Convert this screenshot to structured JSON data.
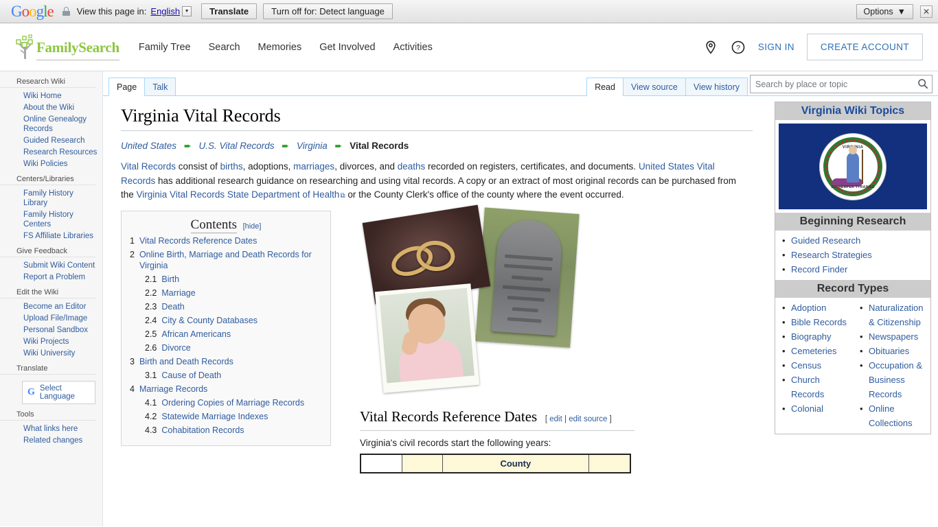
{
  "translate_bar": {
    "logo": "Google",
    "lock_icon": "lock-icon",
    "view_label": "View this page in:",
    "language": "English",
    "caret_icon": "chevron-down-icon",
    "translate_button": "Translate",
    "turn_off_button": "Turn off for: Detect language",
    "options_button": "Options",
    "options_caret": "▼",
    "close_icon": "✕"
  },
  "header": {
    "logo_text": "FamilySearch",
    "tree_icon": "family-tree-icon",
    "nav": [
      {
        "label": "Family Tree"
      },
      {
        "label": "Search"
      },
      {
        "label": "Memories"
      },
      {
        "label": "Get Involved"
      },
      {
        "label": "Activities"
      }
    ],
    "location_icon": "map-pin-icon",
    "help_icon": "help-circle-icon",
    "sign_in": "SIGN IN",
    "create_account": "CREATE ACCOUNT"
  },
  "sidebar": {
    "groups": [
      {
        "title": "Research Wiki",
        "items": [
          "Wiki Home",
          "About the Wiki",
          "Online Genealogy Records",
          "Guided Research",
          "Research Resources",
          "Wiki Policies"
        ]
      },
      {
        "title": "Centers/Libraries",
        "items": [
          "Family History Library",
          "Family History Centers",
          "FS Affiliate Libraries"
        ]
      },
      {
        "title": "Give Feedback",
        "items": [
          "Submit Wiki Content",
          "Report a Problem"
        ]
      },
      {
        "title": "Edit the Wiki",
        "items": [
          "Become an Editor",
          "Upload File/Image",
          "Personal Sandbox",
          "Wiki Projects",
          "Wiki University"
        ]
      },
      {
        "title": "Translate",
        "items": []
      },
      {
        "title": "Tools",
        "items": [
          "What links here",
          "Related changes"
        ]
      }
    ],
    "select_language": "Select Language",
    "google_g": "G"
  },
  "tabs": {
    "left": [
      {
        "label": "Page",
        "active": true
      },
      {
        "label": "Talk",
        "active": false
      }
    ],
    "right": [
      {
        "label": "Read",
        "active": true
      },
      {
        "label": "View source",
        "active": false
      },
      {
        "label": "View history",
        "active": false
      }
    ]
  },
  "search": {
    "placeholder": "Search by place or topic",
    "value": "",
    "icon": "search-icon"
  },
  "article": {
    "title": "Virginia Vital Records",
    "breadcrumb": [
      {
        "label": "United States",
        "current": false
      },
      {
        "label": "U.S. Vital Records",
        "current": false
      },
      {
        "label": "Virginia",
        "current": false
      },
      {
        "label": "Vital Records",
        "current": true
      }
    ],
    "arrow_icon": "➨",
    "intro": {
      "p1_a": "Vital Records",
      "p1_b": " consist of ",
      "p1_births": "births",
      "p1_c": ", adoptions, ",
      "p1_marriages": "marriages",
      "p1_d": ", divorces, and ",
      "p1_deaths": "deaths",
      "p1_e": " recorded on registers, certificates, and documents. ",
      "p1_usvr": "United States Vital Records",
      "p1_f": " has additional research guidance on researching and using vital records. A copy or an extract of most original records can be purchased from the ",
      "p1_dept": "Virginia Vital Records State Department of Health",
      "p1_g": " or the County Clerk's office of the county where the event occurred."
    },
    "toc": {
      "title": "Contents",
      "hide": "[hide]",
      "entries": [
        {
          "num": "1",
          "text": "Vital Records Reference Dates",
          "level": 1
        },
        {
          "num": "2",
          "text": "Online Birth, Marriage and Death Records for Virginia",
          "level": 1
        },
        {
          "num": "2.1",
          "text": "Birth",
          "level": 2
        },
        {
          "num": "2.2",
          "text": "Marriage",
          "level": 2
        },
        {
          "num": "2.3",
          "text": "Death",
          "level": 2
        },
        {
          "num": "2.4",
          "text": "City & County Databases",
          "level": 2
        },
        {
          "num": "2.5",
          "text": "African Americans",
          "level": 2
        },
        {
          "num": "2.6",
          "text": "Divorce",
          "level": 2
        },
        {
          "num": "3",
          "text": "Birth and Death Records",
          "level": 1
        },
        {
          "num": "3.1",
          "text": "Cause of Death",
          "level": 2
        },
        {
          "num": "4",
          "text": "Marriage Records",
          "level": 1
        },
        {
          "num": "4.1",
          "text": "Ordering Copies of Marriage Records",
          "level": 2
        },
        {
          "num": "4.2",
          "text": "Statewide Marriage Indexes",
          "level": 2
        },
        {
          "num": "4.3",
          "text": "Cohabitation Records",
          "level": 2
        }
      ]
    },
    "collage": {
      "rings_photo": "wedding-rings-photo",
      "gravestone_photo": "gravestone-photo",
      "baby_photo": "baby-portrait-photo"
    },
    "section": {
      "title": "Vital Records Reference Dates",
      "edit_open": "[",
      "edit": "edit",
      "edit_sep": "|",
      "edit_source": "edit source",
      "edit_close": "]",
      "paragraph": "Virginia's civil records start the following years:",
      "table_headers": [
        "",
        "",
        "County",
        ""
      ]
    }
  },
  "rail": {
    "topics_title": "Virginia Wiki Topics",
    "flag_alt": "virginia-state-flag",
    "flag_seal_top": "VIRGINIA",
    "flag_seal_bottom": "SIC SEMPER TYRANNIS",
    "beginning_title": "Beginning Research",
    "beginning_items": [
      "Guided Research",
      "Research Strategies",
      "Record Finder"
    ],
    "record_types_title": "Record Types",
    "record_types_col1": [
      "Adoption",
      "Bible Records",
      "Biography",
      "Cemeteries",
      "Census",
      "Church Records",
      "Colonial"
    ],
    "record_types_col2": [
      "Naturalization & Citizenship",
      "Newspapers",
      "Obituaries",
      "Occupation & Business Records",
      "Online Collections"
    ]
  },
  "colors": {
    "fs_green": "#8dc63f",
    "link_blue": "#2f5c9e",
    "rail_header_gray": "#cccccc",
    "rail_header_blue": "#1a4b9c",
    "flag_blue": "#13307f",
    "table_cream": "#fcf8d8",
    "arrow_green": "#2aa02a"
  }
}
